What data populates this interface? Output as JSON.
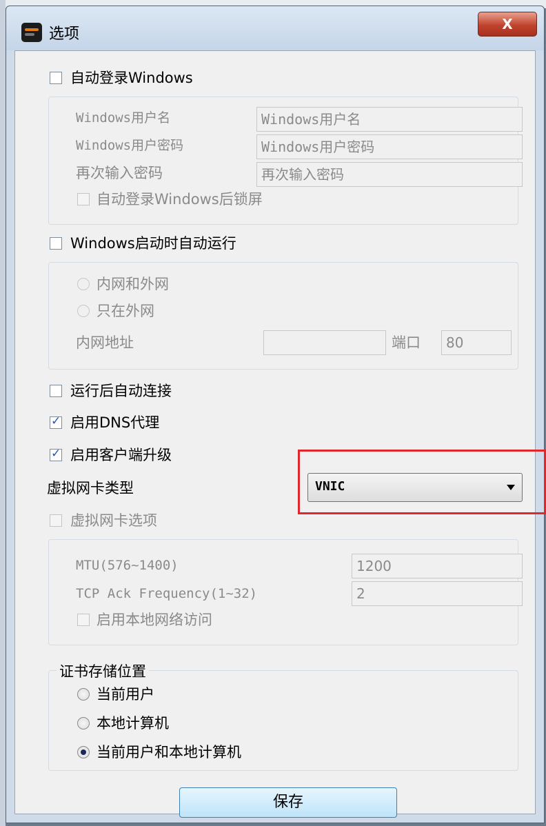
{
  "window": {
    "title": "选项",
    "close_label": "X"
  },
  "auto_login": {
    "label": "自动登录Windows",
    "checked": false,
    "username_label": "Windows用户名",
    "username_placeholder": "Windows用户名",
    "password_label": "Windows用户密码",
    "password_placeholder": "Windows用户密码",
    "confirm_label": "再次输入密码",
    "confirm_placeholder": "再次输入密码",
    "lock_label": "自动登录Windows后锁屏"
  },
  "startup": {
    "label": "Windows启动时自动运行",
    "radio_intranet_extranet": "内网和外网",
    "radio_extranet_only": "只在外网",
    "intranet_address_label": "内网地址",
    "intranet_address_value": "",
    "port_label": "端口",
    "port_value": "80"
  },
  "auto_connect": {
    "label": "运行后自动连接",
    "checked": false
  },
  "dns_proxy": {
    "label": "启用DNS代理",
    "checked": true
  },
  "client_upgrade": {
    "label": "启用客户端升级",
    "checked": true
  },
  "vnic": {
    "label": "虚拟网卡类型",
    "selected": "VNIC"
  },
  "vnic_options": {
    "label": "虚拟网卡选项",
    "mtu_label": "MTU(576~1400)",
    "mtu_value": "1200",
    "tcp_label": "TCP Ack Frequency(1~32)",
    "tcp_value": "2",
    "local_network_label": "启用本地网络访问"
  },
  "cert_store": {
    "legend": "证书存储位置",
    "options": [
      "当前用户",
      "本地计算机",
      "当前用户和本地计算机"
    ],
    "selected_index": 2
  },
  "save_button": "保存"
}
